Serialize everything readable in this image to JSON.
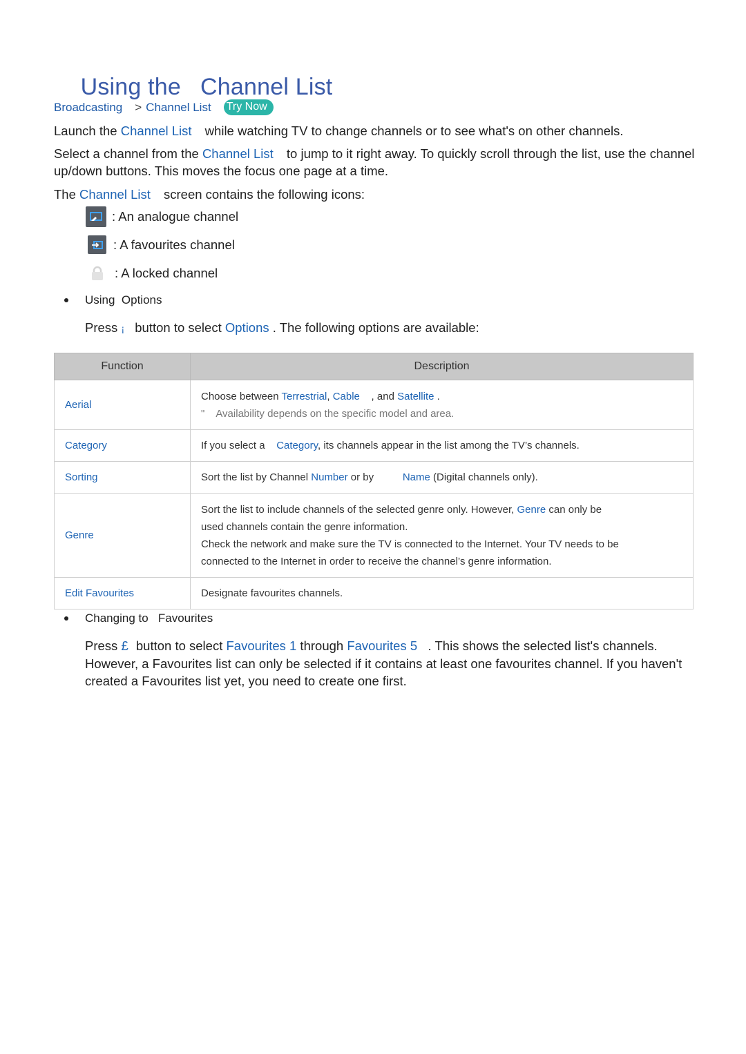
{
  "title": {
    "part1": "Using the",
    "part2": "Channel List"
  },
  "breadcrumb": {
    "item1": "Broadcasting",
    "separator": ">",
    "item2": "Channel List",
    "try_now": "Try Now"
  },
  "intro": {
    "p1_pre": "Launch the ",
    "p1_link": "Channel List",
    "p1_post": " while watching TV to change channels or to see what's on other channels.",
    "p2_pre": "Select a channel from the ",
    "p2_link": "Channel List",
    "p2_post": " to jump to it right away. To quickly scroll through the list, use the channel up/down buttons. This moves the focus one page at a time.",
    "p3_pre": "The ",
    "p3_link": "Channel List",
    "p3_post": " screen contains the following icons:"
  },
  "icons": [
    {
      "icon": "analogue-channel-icon",
      "label": ": An analogue channel"
    },
    {
      "icon": "favourites-channel-icon",
      "label": ": A favourites channel"
    },
    {
      "icon": "locked-channel-icon",
      "label": ": A locked channel"
    }
  ],
  "options_section": {
    "heading": "Using  Options",
    "press_pre": "Press ",
    "press_key": "¡",
    "press_mid": " button to select ",
    "press_link": "Options",
    "press_post": " . The following options are available:"
  },
  "table": {
    "headers": [
      "Function",
      "Description"
    ],
    "rows": [
      {
        "function": "Aerial",
        "desc_pre": "Choose between ",
        "l1": "Terrestrial",
        "c1": ", ",
        "l2": "Cable",
        "c2": "    , and ",
        "l3": "Satellite",
        "c3": " .",
        "note_mark": "\"",
        "note": "Availability depends on the specific model and area."
      },
      {
        "function": "Category",
        "desc_pre": "If you select a    ",
        "l1": "Category",
        "desc_post": ", its channels appear in the list among the TV’s channels."
      },
      {
        "function": "Sorting",
        "desc_pre": "Sort the list by Channel ",
        "l1": "Number",
        "desc_mid": " or by          ",
        "l2": "Name",
        "desc_post": " (Digital channels only)."
      },
      {
        "function": "Genre",
        "desc_pre": "Sort the list to include channels of the selected genre only. However, ",
        "l1": "Genre",
        "desc_post": " can only be used channels contain the genre information.",
        "desc_2": "Check the network and make sure the TV is connected to the Internet. Your TV needs to be connected to the Internet in order to receive the channel’s genre information."
      },
      {
        "function": "Edit Favourites",
        "desc_pre": "Designate favourites channels."
      }
    ]
  },
  "favourites_section": {
    "heading": "Changing to   Favourites",
    "press_pre": "Press ",
    "press_key": "£",
    "press_mid": " button to select ",
    "link1": "Favourites 1",
    "through": " through ",
    "link2": "Favourites 5",
    "press_post": "   . This shows the selected list's channels. However, a Favourites list can only be selected if it contains at least one favourites channel. If you haven't created a Favourites list yet, you need to create one first."
  },
  "colors": {
    "title": "#3a5aa8",
    "link": "#1e64b4",
    "try_now_bg": "#2bb5a8",
    "table_header_bg": "#c8c8c8"
  }
}
